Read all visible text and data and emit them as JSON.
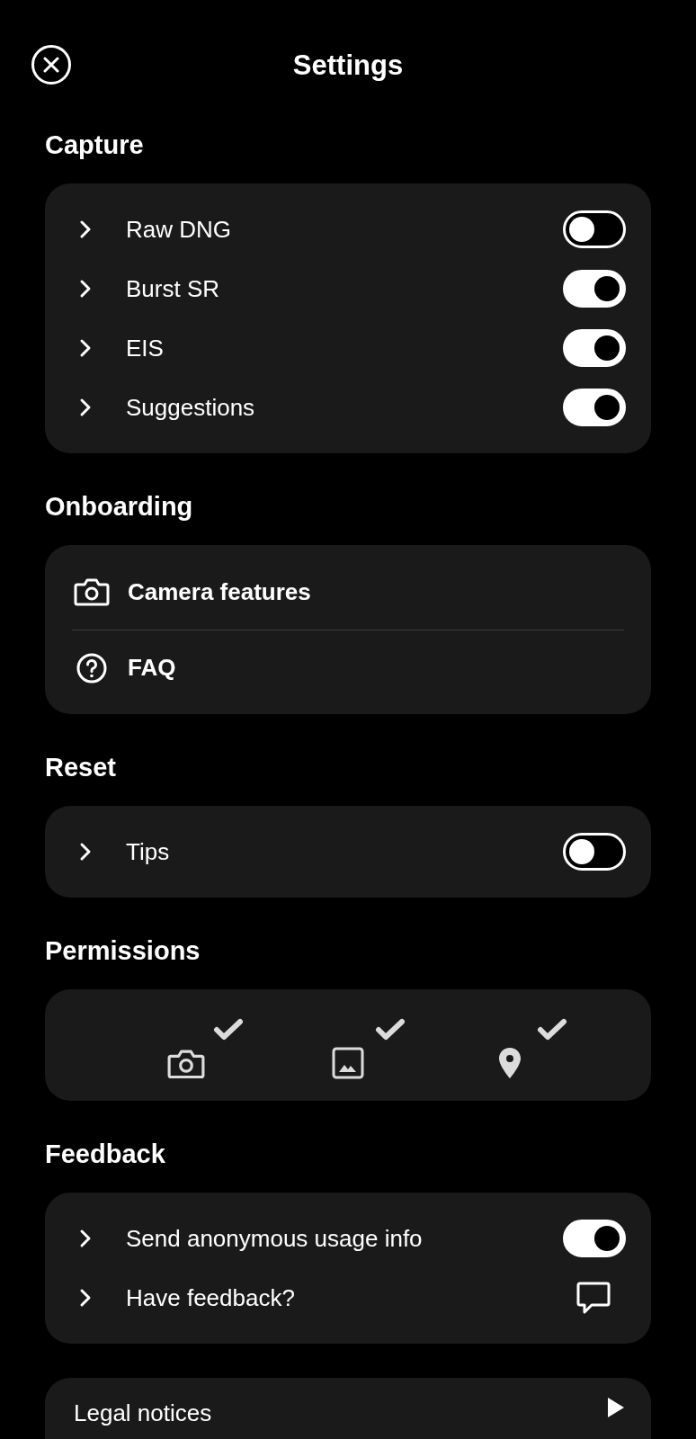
{
  "header": {
    "title": "Settings"
  },
  "sections": [
    {
      "title": "Capture",
      "kind": "rows",
      "items": [
        {
          "label": "Raw DNG",
          "kind": "toggle",
          "on": false
        },
        {
          "label": "Burst SR",
          "kind": "toggle",
          "on": true
        },
        {
          "label": "EIS",
          "kind": "toggle",
          "on": true
        },
        {
          "label": "Suggestions",
          "kind": "toggle",
          "on": true
        }
      ]
    },
    {
      "title": "Onboarding",
      "kind": "links",
      "items": [
        {
          "label": "Camera features",
          "kind": "camera"
        },
        {
          "label": "FAQ",
          "kind": "question"
        }
      ]
    },
    {
      "title": "Reset",
      "kind": "rows",
      "items": [
        {
          "label": "Tips",
          "kind": "toggle",
          "on": false
        }
      ]
    },
    {
      "title": "Permissions",
      "kind": "permissions",
      "items": [
        {
          "kind": "camera",
          "granted": true
        },
        {
          "kind": "image",
          "granted": true
        },
        {
          "kind": "location",
          "granted": true
        }
      ]
    },
    {
      "title": "Feedback",
      "kind": "rows",
      "items": [
        {
          "label": "Send anonymous usage info",
          "kind": "toggle",
          "on": true
        },
        {
          "label": "Have feedback?",
          "kind": "comment"
        }
      ]
    }
  ],
  "footer": {
    "label": "Legal notices"
  }
}
